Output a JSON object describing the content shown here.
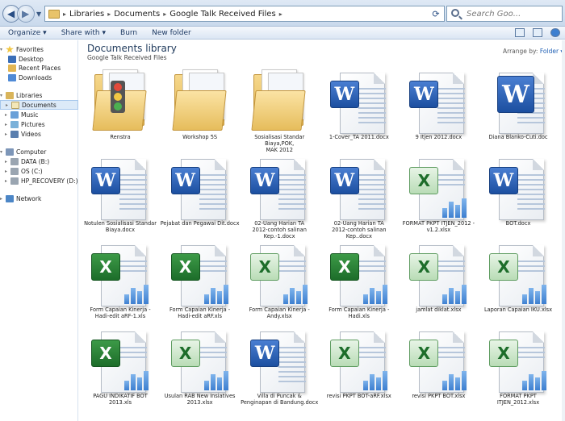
{
  "address": {
    "crumbs": [
      "Libraries",
      "Documents",
      "Google Talk Received Files"
    ],
    "search_placeholder": "Search Goo..."
  },
  "toolbar": {
    "organize": "Organize ▾",
    "share_with": "Share with ▾",
    "burn": "Burn",
    "new_folder": "New folder"
  },
  "sidebar": {
    "favorites_header": "Favorites",
    "favorites": [
      "Desktop",
      "Recent Places",
      "Downloads"
    ],
    "libraries_header": "Libraries",
    "libraries": [
      "Documents",
      "Music",
      "Pictures",
      "Videos"
    ],
    "computer_header": "Computer",
    "drives": [
      "DATA (B:)",
      "OS (C:)",
      "HP_RECOVERY (D:)"
    ],
    "network": "Network"
  },
  "main": {
    "title": "Documents library",
    "subtitle": "Google Talk Received Files",
    "arrange_label": "Arrange by:",
    "arrange_value": "Folder ▾"
  },
  "files": [
    {
      "name": "Renstra",
      "kind": "folder-traffic"
    },
    {
      "name": "Workshop 5S",
      "kind": "folder"
    },
    {
      "name": "Sosialisasi Standar Biaya,POK,\nMAK 2012",
      "kind": "folder"
    },
    {
      "name": "1-Cover_TA 2011.docx",
      "kind": "word"
    },
    {
      "name": "9 Itjen 2012.docx",
      "kind": "word"
    },
    {
      "name": "Diana Blanko-Cuti.doc",
      "kind": "word-solo"
    },
    {
      "name": "Notulen Sosialisasi Standar\nBiaya.docx",
      "kind": "word"
    },
    {
      "name": "Pejabat dan Pegawai Dit.docx",
      "kind": "word"
    },
    {
      "name": "02-Uang Harian TA\n2012-contoh salinan\nKep.-1.docx",
      "kind": "word"
    },
    {
      "name": "02-Uang Harian TA\n2012-contoh salinan\nKep..docx",
      "kind": "word"
    },
    {
      "name": "FORMAT PKPT ITJEN_2012 -\nv1.2.xlsx",
      "kind": "excel-light"
    },
    {
      "name": "BOT.docx",
      "kind": "word"
    },
    {
      "name": "Form Capaian Kinerja -\nHadi-edit aRF-1.xls",
      "kind": "excel"
    },
    {
      "name": "Form Capaian Kinerja -\nHadi-edit aRF.xls",
      "kind": "excel"
    },
    {
      "name": "Form Capaian Kinerja -\nAndy.xlsx",
      "kind": "excel-light"
    },
    {
      "name": "Form Capaian Kinerja -\nHadi.xls",
      "kind": "excel"
    },
    {
      "name": "jamlat diklat.xlsx",
      "kind": "excel-light"
    },
    {
      "name": "Laporan Capaian IKU.xlsx",
      "kind": "excel-light"
    },
    {
      "name": "PAGU INDIKATIF BOT\n2013.xls",
      "kind": "excel"
    },
    {
      "name": "Usulan RAB New Insiatives\n2013.xlsx",
      "kind": "excel-light"
    },
    {
      "name": "Villa di Puncak &\nPenginapan di Bandung.docx",
      "kind": "word"
    },
    {
      "name": "revisi PKPT BOT-aRF.xlsx",
      "kind": "excel-light"
    },
    {
      "name": "revisi PKPT BOT.xlsx",
      "kind": "excel-light"
    },
    {
      "name": "FORMAT PKPT\nITJEN_2012.xlsx",
      "kind": "excel-light"
    }
  ],
  "colors": {
    "accent": "#1e395b",
    "selection": "#dceaf8",
    "word": "#1c4fa0",
    "excel": "#1d6d2a",
    "folder": "#e2b653"
  }
}
